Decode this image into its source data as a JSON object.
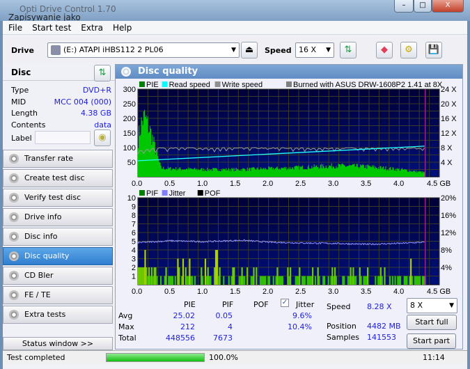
{
  "window": {
    "title": "Opti Drive Control 1.70",
    "behind_title": "Zapisywanie jako",
    "minimize": "–",
    "maximize": "□",
    "close": "X"
  },
  "menu": [
    "File",
    "Start test",
    "Extra",
    "Help"
  ],
  "toolbar": {
    "drive_label": "Drive",
    "drive_value": "(E:)   ATAPI iHBS112   2 PL06",
    "speed_label": "Speed",
    "speed_value": "16 X"
  },
  "disc": {
    "title": "Disc",
    "rows": [
      {
        "k": "Type",
        "v": "DVD+R"
      },
      {
        "k": "MID",
        "v": "MCC 004 (000)"
      },
      {
        "k": "Length",
        "v": "4.38 GB"
      },
      {
        "k": "Contents",
        "v": "data"
      }
    ],
    "label_label": "Label",
    "label_value": ""
  },
  "nav": [
    {
      "label": "Transfer rate"
    },
    {
      "label": "Create test disc"
    },
    {
      "label": "Verify test disc"
    },
    {
      "label": "Drive info"
    },
    {
      "label": "Disc info"
    },
    {
      "label": "Disc quality",
      "selected": true
    },
    {
      "label": "CD Bler"
    },
    {
      "label": "FE / TE"
    },
    {
      "label": "Extra tests"
    }
  ],
  "status_window": "Status window >>",
  "panel": {
    "title": "Disc quality"
  },
  "chart_data": [
    {
      "type": "bar",
      "legend": [
        "PIE",
        "Read speed",
        "Write speed"
      ],
      "legend_right": "Burned with ASUS DRW-1608P2 1.41 at 8X",
      "colors": {
        "PIE": "#00c000",
        "Read speed": "#00ffff",
        "Write speed": "#909090"
      },
      "x_ticks": [
        "0.0",
        "0.5",
        "1.0",
        "1.5",
        "2.0",
        "2.5",
        "3.0",
        "3.5",
        "4.0",
        "4.5 GB"
      ],
      "xlim": [
        0,
        4.5
      ],
      "y_ticks": [
        "50",
        "100",
        "150",
        "200",
        "250",
        "300"
      ],
      "ylim": [
        0,
        300
      ],
      "y2_ticks": [
        "4 X",
        "8 X",
        "12 X",
        "16 X",
        "20 X",
        "24 X"
      ],
      "y2lim": [
        0,
        24
      ],
      "end_gb": 4.38,
      "pie_profile": [
        [
          0,
          130
        ],
        [
          0.05,
          185
        ],
        [
          0.1,
          205
        ],
        [
          0.15,
          175
        ],
        [
          0.2,
          145
        ],
        [
          0.25,
          105
        ],
        [
          0.3,
          65
        ],
        [
          0.35,
          30
        ],
        [
          0.5,
          28
        ],
        [
          1.0,
          25
        ],
        [
          1.5,
          25
        ],
        [
          2.0,
          28
        ],
        [
          2.5,
          32
        ],
        [
          3.0,
          38
        ],
        [
          3.5,
          35
        ],
        [
          4.0,
          25
        ],
        [
          4.38,
          15
        ]
      ],
      "read_speed": [
        [
          0,
          4.4
        ],
        [
          4.38,
          8.4
        ]
      ],
      "write_speed": 8.0
    },
    {
      "type": "bar",
      "legend": [
        "PIF",
        "Jitter",
        "POF"
      ],
      "colors": {
        "PIF": "#00c000",
        "Jitter": "#8080ff",
        "POF": "#000000"
      },
      "x_ticks": [
        "0.0",
        "0.5",
        "1.0",
        "1.5",
        "2.0",
        "2.5",
        "3.0",
        "3.5",
        "4.0",
        "4.5 GB"
      ],
      "xlim": [
        0,
        4.5
      ],
      "y_ticks": [
        "1",
        "2",
        "3",
        "4",
        "5",
        "6",
        "7",
        "8",
        "9",
        "10"
      ],
      "ylim": [
        0,
        10
      ],
      "y2_ticks": [
        "4%",
        "8%",
        "12%",
        "16%",
        "20%"
      ],
      "y2lim": [
        0,
        20
      ],
      "end_gb": 4.38,
      "jitter_profile": [
        [
          0,
          9.7
        ],
        [
          0.5,
          10.1
        ],
        [
          1.0,
          9.9
        ],
        [
          1.6,
          10.2
        ],
        [
          2.0,
          9.8
        ],
        [
          2.5,
          9.6
        ],
        [
          3.0,
          9.5
        ],
        [
          3.5,
          9.3
        ],
        [
          4.0,
          9.5
        ],
        [
          4.38,
          9.8
        ]
      ],
      "pif_max": 4
    }
  ],
  "stats": {
    "headers": [
      "PIE",
      "PIF",
      "POF",
      "Jitter"
    ],
    "jitter_checked": true,
    "rows": [
      {
        "label": "Avg",
        "pie": "25.02",
        "pif": "0.05",
        "pof": "",
        "jitter": "9.6%"
      },
      {
        "label": "Max",
        "pie": "212",
        "pif": "4",
        "pof": "",
        "jitter": "10.4%"
      },
      {
        "label": "Total",
        "pie": "448556",
        "pif": "7673",
        "pof": "",
        "jitter": ""
      }
    ],
    "speed_label": "Speed",
    "speed_value": "8.28 X",
    "position_label": "Position",
    "position_value": "4482 MB",
    "samples_label": "Samples",
    "samples_value": "141553",
    "speed_select": "8 X",
    "start_full": "Start full",
    "start_part": "Start part"
  },
  "statusbar": {
    "text": "Test completed",
    "progress": 100,
    "progress_text": "100.0%",
    "time": "11:14"
  }
}
